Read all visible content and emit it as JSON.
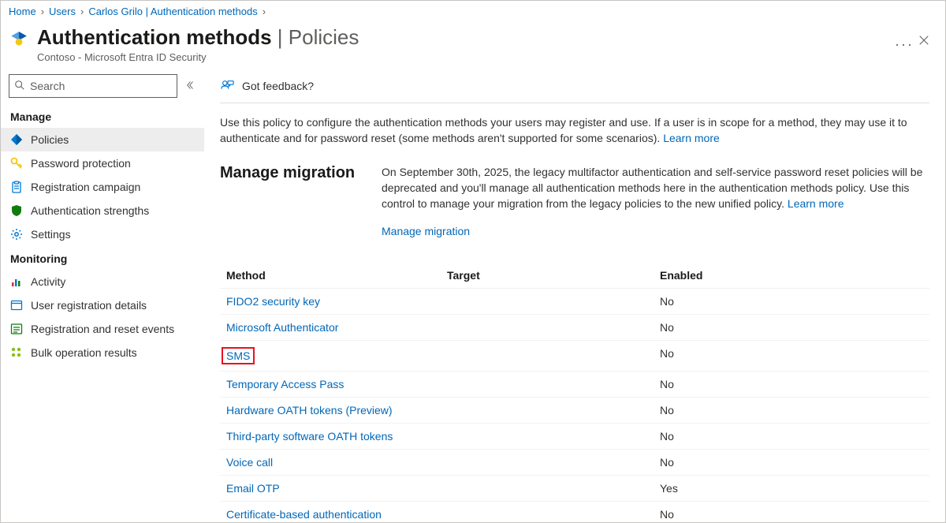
{
  "breadcrumb": {
    "items": [
      "Home",
      "Users",
      "Carlos Grilo | Authentication methods"
    ]
  },
  "header": {
    "title_main": "Authentication methods",
    "title_sub": "Policies",
    "subtitle": "Contoso - Microsoft Entra ID Security"
  },
  "sidebar": {
    "search_placeholder": "Search",
    "groups": [
      {
        "label": "Manage",
        "items": [
          {
            "label": "Policies",
            "icon": "diamond",
            "color": "#0078d4",
            "active": true
          },
          {
            "label": "Password protection",
            "icon": "key",
            "color": "#f2c811"
          },
          {
            "label": "Registration campaign",
            "icon": "clipboard",
            "color": "#0078d4"
          },
          {
            "label": "Authentication strengths",
            "icon": "shield",
            "color": "#107c10"
          },
          {
            "label": "Settings",
            "icon": "gear",
            "color": "#0078d4"
          }
        ]
      },
      {
        "label": "Monitoring",
        "items": [
          {
            "label": "Activity",
            "icon": "bars",
            "color": "#d13438"
          },
          {
            "label": "User registration details",
            "icon": "browser",
            "color": "#0078d4"
          },
          {
            "label": "Registration and reset events",
            "icon": "list",
            "color": "#107c10"
          },
          {
            "label": "Bulk operation results",
            "icon": "bulk",
            "color": "#8cbd18"
          }
        ]
      }
    ]
  },
  "main": {
    "feedback_label": "Got feedback?",
    "intro_text": "Use this policy to configure the authentication methods your users may register and use. If a user is in scope for a method, they may use it to authenticate and for password reset (some methods aren't supported for some scenarios). ",
    "intro_learn_more": "Learn more",
    "migration": {
      "heading": "Manage migration",
      "body": "On September 30th, 2025, the legacy multifactor authentication and self-service password reset policies will be deprecated and you'll manage all authentication methods here in the authentication methods policy. Use this control to manage your migration from the legacy policies to the new unified policy. ",
      "learn_more": "Learn more",
      "link": "Manage migration"
    },
    "table": {
      "headers": {
        "method": "Method",
        "target": "Target",
        "enabled": "Enabled"
      },
      "rows": [
        {
          "method": "FIDO2 security key",
          "target": "",
          "enabled": "No",
          "highlight": false
        },
        {
          "method": "Microsoft Authenticator",
          "target": "",
          "enabled": "No",
          "highlight": false
        },
        {
          "method": "SMS",
          "target": "",
          "enabled": "No",
          "highlight": true
        },
        {
          "method": "Temporary Access Pass",
          "target": "",
          "enabled": "No",
          "highlight": false
        },
        {
          "method": "Hardware OATH tokens (Preview)",
          "target": "",
          "enabled": "No",
          "highlight": false
        },
        {
          "method": "Third-party software OATH tokens",
          "target": "",
          "enabled": "No",
          "highlight": false
        },
        {
          "method": "Voice call",
          "target": "",
          "enabled": "No",
          "highlight": false
        },
        {
          "method": "Email OTP",
          "target": "",
          "enabled": "Yes",
          "highlight": false
        },
        {
          "method": "Certificate-based authentication",
          "target": "",
          "enabled": "No",
          "highlight": false
        }
      ]
    }
  }
}
